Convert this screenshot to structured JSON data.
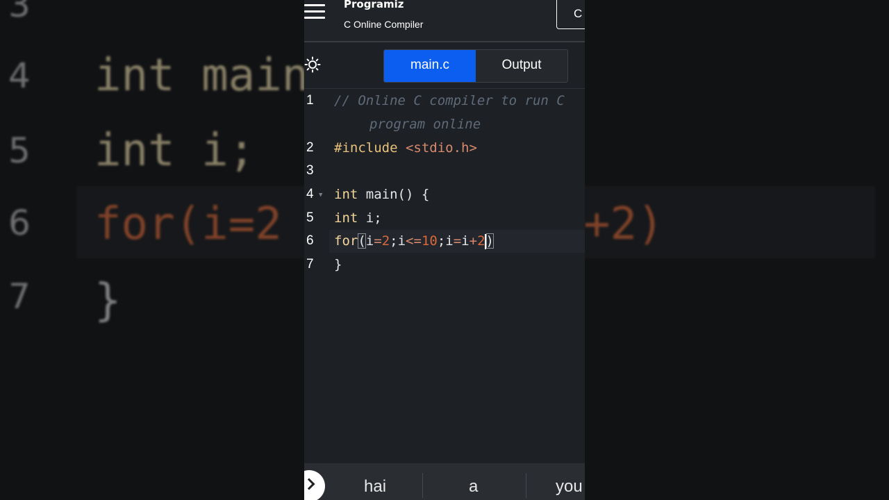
{
  "header": {
    "brand": "Programiz",
    "subtitle": "C Online Compiler",
    "run_label": "C"
  },
  "tabs": [
    {
      "label": "main.c",
      "active": true
    },
    {
      "label": "Output",
      "active": false
    }
  ],
  "editor": {
    "line_numbers": [
      "1",
      "2",
      "3",
      "4",
      "5",
      "6",
      "7"
    ],
    "code_lines": [
      "// Online C compiler to run C",
      "program online",
      "#include <stdio.h>",
      "",
      "int main() {",
      "int i;",
      "for(i=2;i<=10;i=i+2)",
      "}"
    ],
    "active_line": "6"
  },
  "keyboard": {
    "suggestions": [
      "hai",
      "a",
      "you"
    ]
  },
  "background": {
    "line_numbers": [
      "3",
      "4",
      "5",
      "6",
      "7"
    ],
    "code": [
      "int main",
      "int i;",
      "for(i=2",
      "+2)",
      "}"
    ]
  },
  "colors": {
    "accent": "#0b5ef0",
    "editor_bg": "#1d2126",
    "keyword": "#f2d59a",
    "number": "#d9693a",
    "comment": "#5f6b78"
  },
  "icons": {
    "menu": "hamburger-icon",
    "theme": "sun-icon",
    "expand": "chevron-right-icon"
  }
}
